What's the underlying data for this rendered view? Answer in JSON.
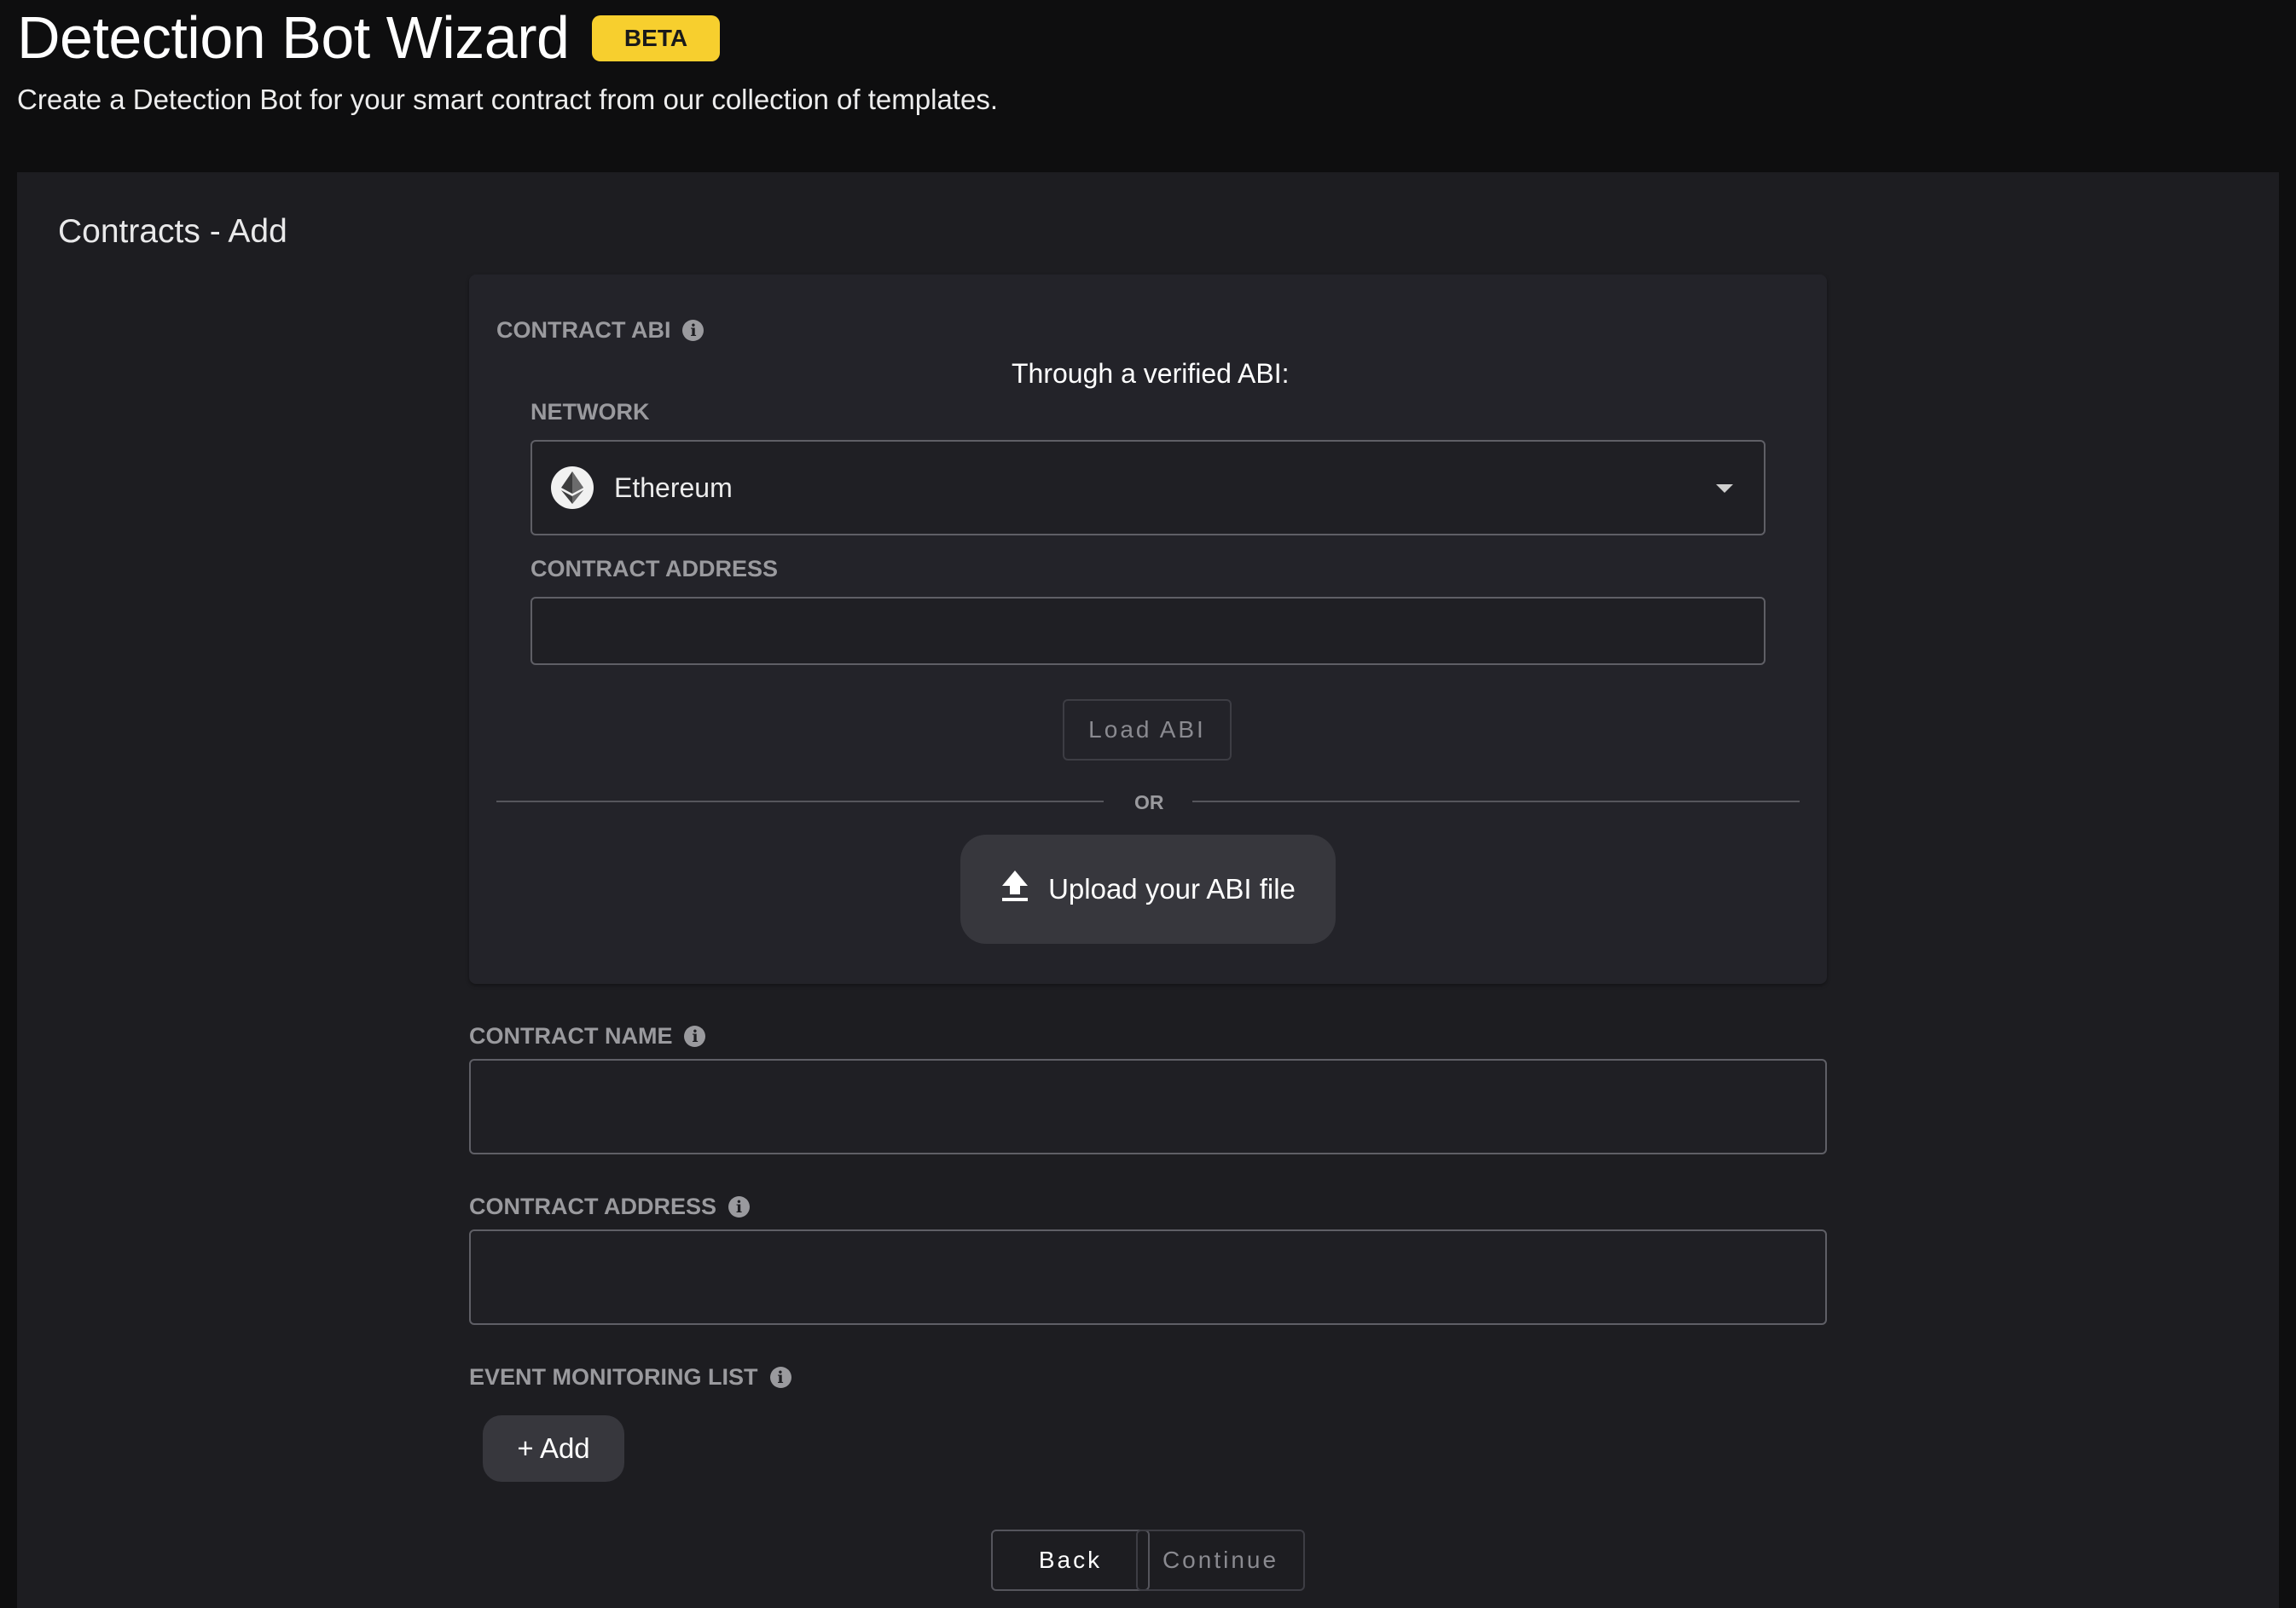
{
  "header": {
    "title": "Detection Bot Wizard",
    "badge": "BETA",
    "subtitle": "Create a Detection Bot for your smart contract from our collection of templates."
  },
  "panel": {
    "title": "Contracts - Add"
  },
  "abi_card": {
    "label": "CONTRACT ABI",
    "verified_heading": "Through a verified ABI:",
    "network_label": "NETWORK",
    "network_value": "Ethereum",
    "contract_address_label": "CONTRACT ADDRESS",
    "contract_address_value": "",
    "load_button": "Load ABI",
    "or_text": "OR",
    "upload_button": "Upload your ABI file"
  },
  "form": {
    "contract_name_label": "CONTRACT NAME",
    "contract_name_value": "",
    "contract_address_label": "CONTRACT ADDRESS",
    "contract_address_value": "",
    "event_list_label": "EVENT MONITORING LIST",
    "add_button": "+ Add"
  },
  "footer": {
    "back_button": "Back",
    "continue_button": "Continue"
  },
  "colors": {
    "background": "#0e0e0f",
    "panel": "#1d1d21",
    "badge": "#f7cf2e"
  },
  "icons": {
    "info": "info-icon",
    "network": "ethereum-icon",
    "dropdown": "chevron-down-icon",
    "upload": "upload-icon"
  }
}
